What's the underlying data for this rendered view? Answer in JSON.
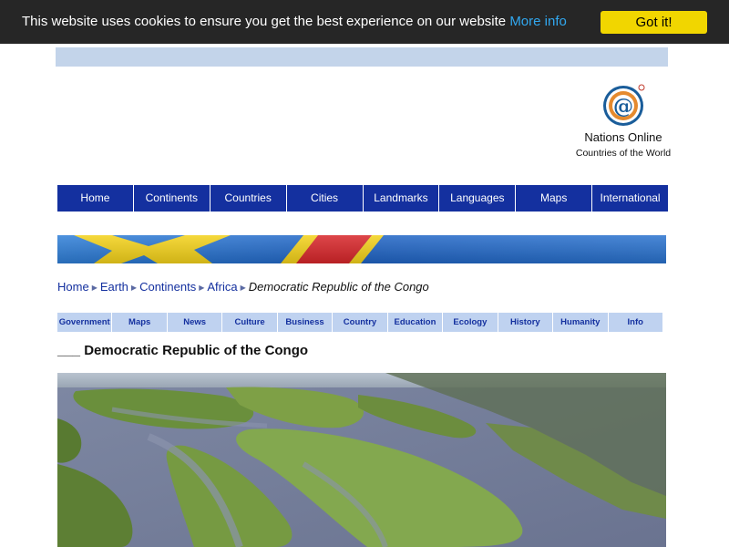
{
  "cookie": {
    "message": "This website uses cookies to ensure you get the best experience on our website",
    "more_info": "More info",
    "accept_label": "Got it!"
  },
  "logo": {
    "icon": "globe-at-icon",
    "name": "Nations Online",
    "tagline": "Countries of the World"
  },
  "main_nav": [
    "Home",
    "Continents",
    "Countries",
    "Cities",
    "Landmarks",
    "Languages",
    "Maps",
    "International"
  ],
  "breadcrumb": {
    "items": [
      "Home",
      "Earth",
      "Continents",
      "Africa"
    ],
    "current": "Democratic Republic of the Congo"
  },
  "sub_nav": [
    "Government",
    "Maps",
    "News",
    "Culture",
    "Business",
    "Country",
    "Education",
    "Ecology",
    "History",
    "Humanity",
    "Info"
  ],
  "page": {
    "title": "___ Democratic Republic of the Congo"
  },
  "colors": {
    "nav_blue": "#14309f",
    "subnav_blue": "#bfd2f0",
    "cookie_bg": "#262626",
    "cookie_button": "#f1d600",
    "link_blue": "#31a8f0"
  }
}
